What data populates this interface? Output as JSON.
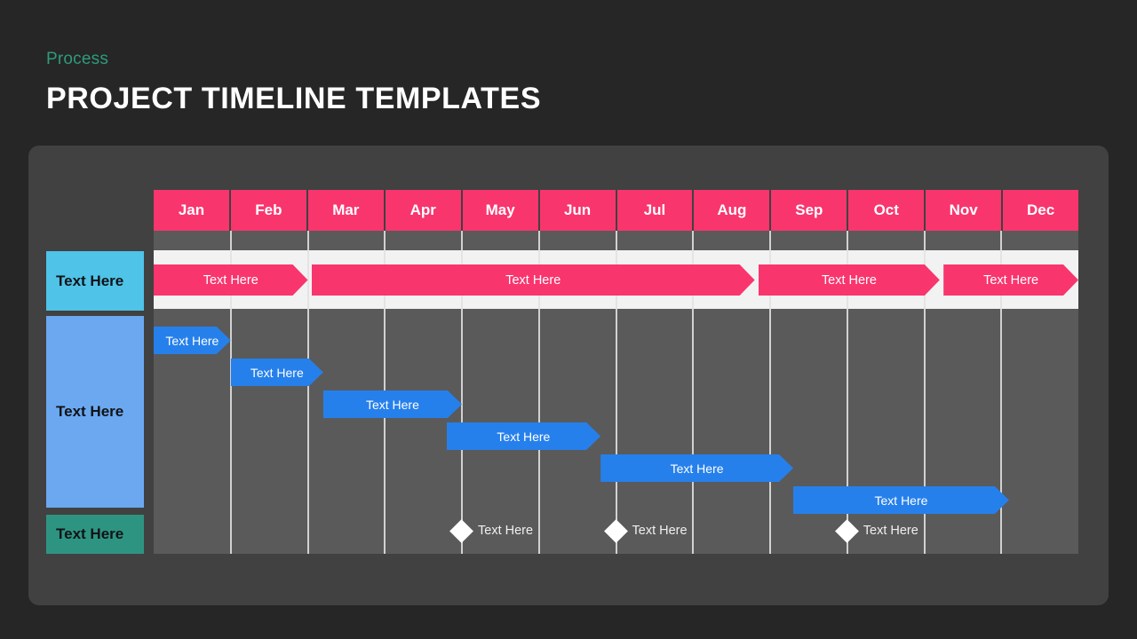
{
  "header": {
    "eyebrow": "Process",
    "title": "PROJECT TIMELINE TEMPLATES"
  },
  "colors": {
    "background": "#262626",
    "card": "#414141",
    "grid_body": "#5A5A5A",
    "month_header": "#F9356E",
    "phase_band": "#F2F2F2",
    "phase_bar": "#F9356E",
    "task_bar": "#2680EB",
    "gridline": "#ECECEC",
    "label_phase": "#4FC3E8",
    "label_tasks": "#6BA8F0",
    "label_milestones": "#2E9482",
    "eyebrow_text": "#2E9B7C",
    "title_text": "#FFFFFF",
    "milestone_diamond": "#FFFFFF"
  },
  "timeline": {
    "months": [
      "Jan",
      "Feb",
      "Mar",
      "Apr",
      "May",
      "Jun",
      "Jul",
      "Aug",
      "Sep",
      "Oct",
      "Nov",
      "Dec"
    ],
    "row_labels": {
      "phase": "Text Here",
      "tasks": "Text Here",
      "milestones": "Text Here"
    },
    "phase_bars": [
      {
        "label": "Text Here",
        "start_month": 0,
        "end_month": 2.0
      },
      {
        "label": "Text Here",
        "start_month": 2.05,
        "end_month": 7.8
      },
      {
        "label": "Text Here",
        "start_month": 7.85,
        "end_month": 10.2
      },
      {
        "label": "Text Here",
        "start_month": 10.25,
        "end_month": 12.0
      }
    ],
    "task_bars": [
      {
        "label": "Text Here",
        "start_month": 0.0,
        "end_month": 1.0
      },
      {
        "label": "Text Here",
        "start_month": 1.0,
        "end_month": 2.2
      },
      {
        "label": "Text Here",
        "start_month": 2.2,
        "end_month": 4.0
      },
      {
        "label": "Text Here",
        "start_month": 3.8,
        "end_month": 5.8
      },
      {
        "label": "Text Here",
        "start_month": 5.8,
        "end_month": 8.3
      },
      {
        "label": "Text Here",
        "start_month": 8.3,
        "end_month": 11.1
      }
    ],
    "milestones": [
      {
        "label": "Text Here",
        "month": 4.0
      },
      {
        "label": "Text Here",
        "month": 6.0
      },
      {
        "label": "Text Here",
        "month": 9.0
      }
    ]
  }
}
